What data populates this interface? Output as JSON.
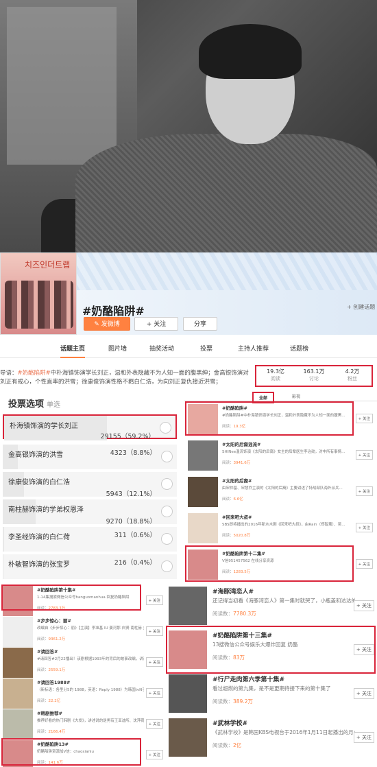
{
  "topic": {
    "cover_title": "치즈인더트랩",
    "title": "#奶酪陷阱#",
    "create_link": "+ 创建话题",
    "post_button": "发微博",
    "follow_button": "+ 关注",
    "share_button": "分享"
  },
  "nav": [
    "话题主页",
    "图片墙",
    "抽奖活动",
    "投票",
    "主持人推荐",
    "话题榜"
  ],
  "guide": {
    "prefix": "导语：",
    "highlight": "#奶酪陷阱#",
    "text": "中朴海镇饰演学长刘正，温和外表隐藏不为人知一面的腹黑绅；金高银饰演对刘正有戒心，个性直率的洪雪；徐康俊饰演性格不羁白仁浩，为向刘正复仇接近洪雪；"
  },
  "stats": [
    {
      "num": "19.3亿",
      "lbl": "阅读"
    },
    {
      "num": "163.1万",
      "lbl": "讨论"
    },
    {
      "num": "4.2万",
      "lbl": "粉丝"
    }
  ],
  "vote": {
    "title": "投票选项",
    "mode": "单选",
    "options": [
      {
        "name": "朴海镇饰演的学长刘正",
        "count": "29155（59.2%）",
        "pct": 59.2
      },
      {
        "name": "金高银饰演的洪雪",
        "count": "4323（8.8%）",
        "pct": 8.8
      },
      {
        "name": "徐康俊饰演的白仁浩",
        "count": "5943（12.1%）",
        "pct": 12.1
      },
      {
        "name": "南柱赫饰演的学弟权恩泽",
        "count": "9270（18.8%）",
        "pct": 18.8
      },
      {
        "name": "李圣经饰演的白仁荷",
        "count": "311（0.6%）",
        "pct": 0.6
      },
      {
        "name": "朴敏智饰演的张宝罗",
        "count": "216（0.4%）",
        "pct": 0.4
      }
    ]
  },
  "right_tabs": [
    "全部",
    "影视"
  ],
  "right_list": [
    {
      "title": "#奶酪陷阱#",
      "desc": "#奶酪陷阱#中朴海镇饰演学长刘正，温和外表隐藏不为人知一面的腹黑...",
      "reads_label": "阅读：",
      "reads": "19.3亿",
      "follow": "+ 关注"
    },
    {
      "title": "#太阳的后裔混流#",
      "desc": "SHINee温流饰演《太阳的后裔》女主的后辈医生李治勋，对中所有事情...",
      "reads_label": "阅读：",
      "reads": "3941.6万",
      "follow": "+ 关注"
    },
    {
      "title": "#太阳的后裔#",
      "desc": "由宋仲基、宋慧乔主演的《太阳的后裔》主要讲述了特战部队海外派兵...",
      "reads_label": "阅读：",
      "reads": "6.6亿",
      "follow": "+ 关注"
    },
    {
      "title": "#回来吧大叔#",
      "desc": "SBS即将播出的2016年新水木剧《回来吧大叔》，由Rain（郑智薰）、吴...",
      "reads_label": "阅读：",
      "reads": "5020.8万",
      "follow": "+ 关注"
    },
    {
      "title": "#奶酪陷阱第十二集#",
      "desc": "V信951457562 在线分享资源",
      "reads_label": "阅读：",
      "reads": "1283.5万",
      "follow": "+ 关注"
    }
  ],
  "left_list": [
    {
      "title": "#奶酪陷阱第十集#",
      "desc": "1-14集搜索微信公众号hanguomanhua 回复奶酪陷阱",
      "reads_label": "阅读：",
      "reads": "2783.3万",
      "follow": "+ 关注"
    },
    {
      "title": "#步步惊心：丽#",
      "desc": "改编自《步步惊心：丽》【主演】李准基 IU 姜河那 白贤 南柱赫 金...",
      "reads_label": "阅读：",
      "reads": "9361.2万",
      "follow": "+ 关注"
    },
    {
      "title": "#请回答#",
      "desc": "#请回答#2月22播出！该剧根据1993年的背后的故事改编，讲述...",
      "reads_label": "阅读：",
      "reads": "2559.1万",
      "follow": "+ 关注"
    },
    {
      "title": "#请回答1988#",
      "desc": "（新标语：各型分5的 1988，英语：Reply 1988）为韩国tvN于2015年...",
      "reads_label": "阅读：",
      "reads": "22.2亿",
      "follow": "+ 关注"
    },
    {
      "title": "#韩剧推荐#",
      "desc": "推荐好看的热门韩剧《大发》，讲述说的是男有王亚迪所、沈萍荷...",
      "reads_label": "阅读：",
      "reads": "2166.4万",
      "follow": "+ 关注"
    },
    {
      "title": "#奶酪陷阱13#",
      "desc": "奶酪陷阱资源加V信：chaoxianlu",
      "reads_label": "阅读：",
      "reads": "141.6万",
      "follow": "+ 关注"
    }
  ],
  "big_list": [
    {
      "title": "#海豚湾恋人#",
      "desc": "还记得当初看《海豚湾恋人》第一集时就哭了，小瓶盖和达达的约定！",
      "reads_label": "阅读数：",
      "reads": "7780.3万",
      "follow": "+ 关注"
    },
    {
      "title": "#奶酪陷阱第十三集#",
      "desc": "13搜微信公众号娱乐大爆炸回复 奶酪",
      "reads_label": "阅读数：",
      "reads": "83万",
      "follow": "+ 关注"
    },
    {
      "title": "#行尸走肉第六季第十集#",
      "desc": "看过超燃的第九集，是不是更期待接下来的第十集了",
      "reads_label": "阅读数：",
      "reads": "389.2万",
      "follow": "+ 关注"
    },
    {
      "title": "#武林学校#",
      "desc": "《武林学校》是韩国KBS电视台于2016年1月11日起播出的月火连续剧",
      "reads_label": "阅读数：",
      "reads": "2亿",
      "follow": "+ 关注"
    }
  ]
}
